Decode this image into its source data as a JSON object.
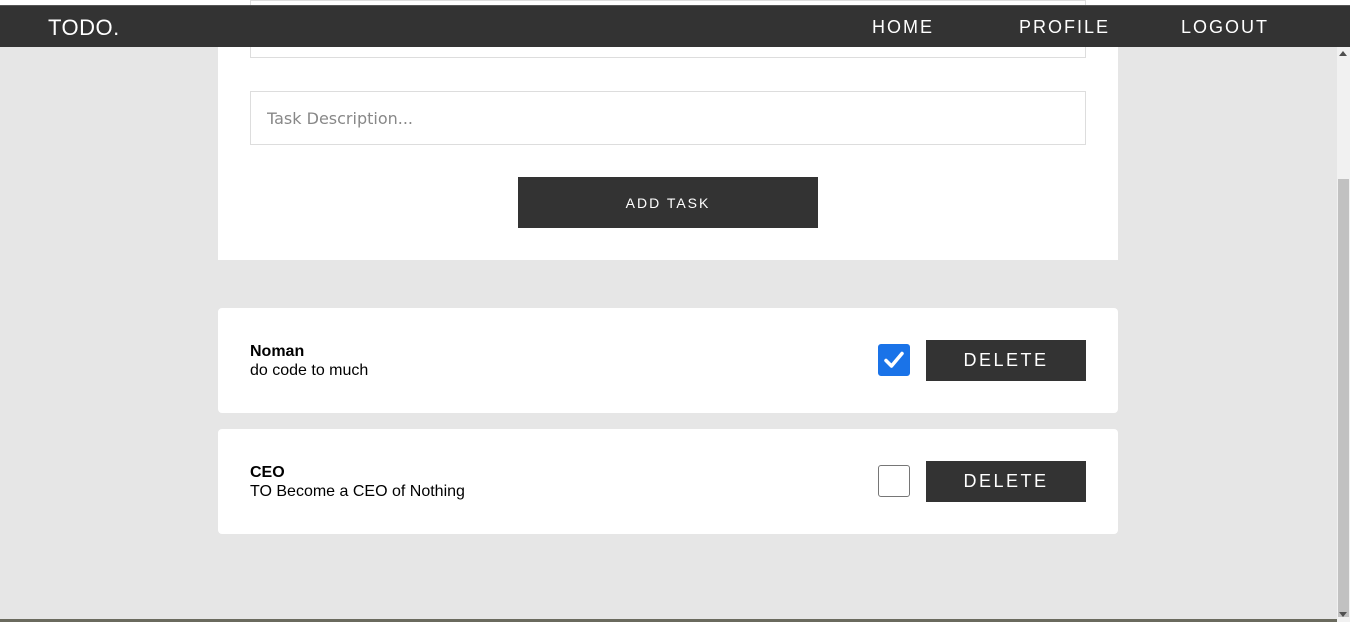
{
  "navbar": {
    "brand": "TODO.",
    "links": {
      "home": "HOME",
      "profile": "PROFILE",
      "logout": "LOGOUT"
    }
  },
  "form": {
    "title_value": "",
    "description_placeholder": "Task Description...",
    "add_button": "ADD TASK"
  },
  "tasks": [
    {
      "title": "Noman",
      "description": "do code to much",
      "completed": true,
      "delete_label": "DELETE"
    },
    {
      "title": "CEO",
      "description": "TO Become a CEO of Nothing",
      "completed": false,
      "delete_label": "DELETE"
    }
  ],
  "colors": {
    "navbar": "#333333",
    "background": "#e6e6e6",
    "checkbox_checked": "#1a73e8",
    "button": "#333333"
  },
  "icons": {
    "checkmark": "check-icon"
  }
}
